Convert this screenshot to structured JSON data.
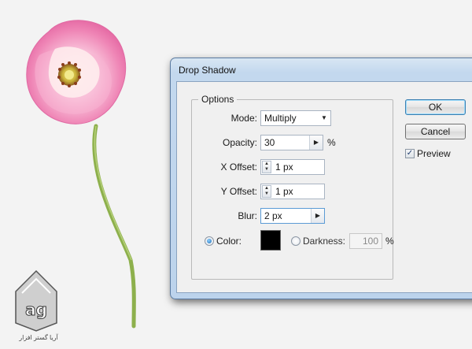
{
  "dialog": {
    "title": "Drop Shadow",
    "group_label": "Options",
    "mode": {
      "label": "Mode:",
      "value": "Multiply"
    },
    "opacity": {
      "label": "Opacity:",
      "value": "30",
      "unit": "%"
    },
    "x_offset": {
      "label": "X Offset:",
      "value": "1 px"
    },
    "y_offset": {
      "label": "Y Offset:",
      "value": "1 px"
    },
    "blur": {
      "label": "Blur:",
      "value": "2 px"
    },
    "color_option": {
      "label": "Color:",
      "selected": true,
      "swatch_color": "#000000"
    },
    "darkness_option": {
      "label": "Darkness:",
      "value": "100",
      "unit": "%",
      "selected": false
    },
    "ok_label": "OK",
    "cancel_label": "Cancel",
    "preview": {
      "label": "Preview",
      "checked": true
    }
  },
  "artwork": {
    "petal_color": "#ef7fb2",
    "stem_color": "#8db04c",
    "center_color": "#d4c24a"
  },
  "watermark": {
    "logo_text": "ag",
    "caption": "آریا گستر افزار"
  },
  "colors": {
    "title_bar": "#c3d8ee",
    "default_button_border": "#3c7fb1"
  }
}
